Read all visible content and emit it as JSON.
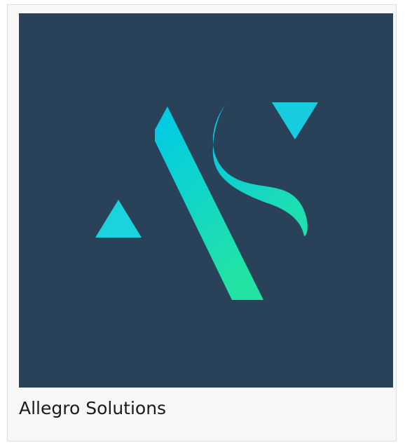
{
  "card": {
    "title": "Allegro Solutions"
  },
  "logo": {
    "icon": "allegro-solutions-logo-icon",
    "lettering": "AS",
    "colors": {
      "background": "#2a4259",
      "mark_light": "#00c8e6",
      "mark_green": "#1ee6a6"
    }
  }
}
